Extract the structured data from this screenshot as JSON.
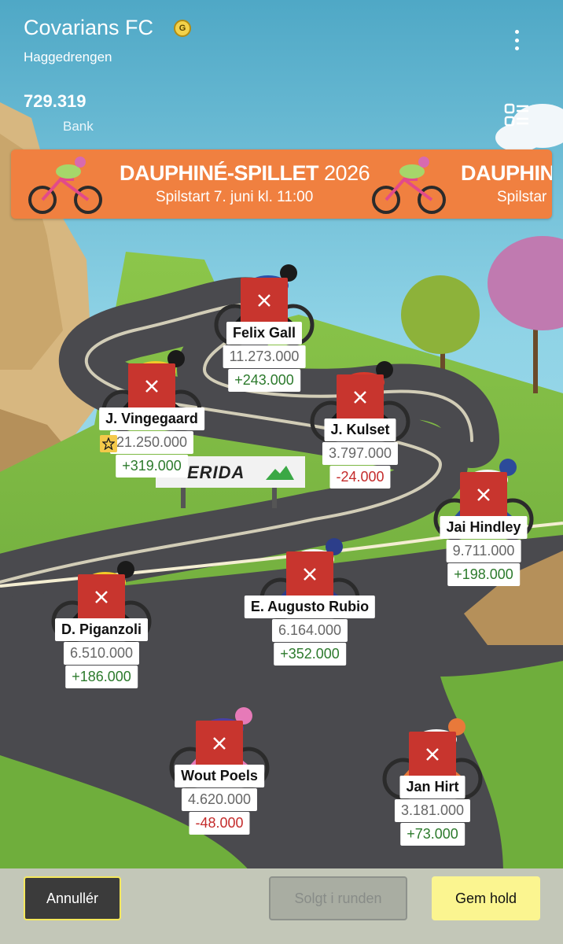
{
  "header": {
    "team_name": "Covarians FC",
    "badge_letter": "G",
    "manager_name": "Haggedrengen",
    "bank_value": "729.319",
    "bank_label": "Bank"
  },
  "banner": {
    "title_bold": "DAUPHINÉ-SPILLET",
    "title_year": "2026",
    "subtitle": "Spilstart 7. juni kl. 11:00",
    "title_bold_cut": "DAUPHINÉ",
    "subtitle_cut": "Spilstar"
  },
  "sponsor": "ERIDA",
  "riders": [
    {
      "name": "Felix Gall",
      "price": "11.273.000",
      "change": "+243.000",
      "trend": "up",
      "captain": false
    },
    {
      "name": "J. Vingegaard",
      "price": "21.250.000",
      "change": "+319.000",
      "trend": "up",
      "captain": true
    },
    {
      "name": "J. Kulset",
      "price": "3.797.000",
      "change": "-24.000",
      "trend": "down",
      "captain": false
    },
    {
      "name": "Jai Hindley",
      "price": "9.711.000",
      "change": "+198.000",
      "trend": "up",
      "captain": false
    },
    {
      "name": "D. Piganzoli",
      "price": "6.510.000",
      "change": "+186.000",
      "trend": "up",
      "captain": false
    },
    {
      "name": "E. Augusto Rubio",
      "price": "6.164.000",
      "change": "+352.000",
      "trend": "up",
      "captain": false
    },
    {
      "name": "Wout Poels",
      "price": "4.620.000",
      "change": "-48.000",
      "trend": "down",
      "captain": false
    },
    {
      "name": "Jan Hirt",
      "price": "3.181.000",
      "change": "+73.000",
      "trend": "up",
      "captain": false
    }
  ],
  "actions": {
    "cancel": "Annullér",
    "sold": "Solgt i runden",
    "save": "Gem hold"
  },
  "colors": {
    "sky": "#8fd3e6",
    "road": "#4a4a4e",
    "grass": "#6fae3c",
    "remove": "#c8352e",
    "positive": "#2c7a2c",
    "negative": "#c42b2b",
    "banner": "#f08040",
    "save": "#fbf590"
  }
}
